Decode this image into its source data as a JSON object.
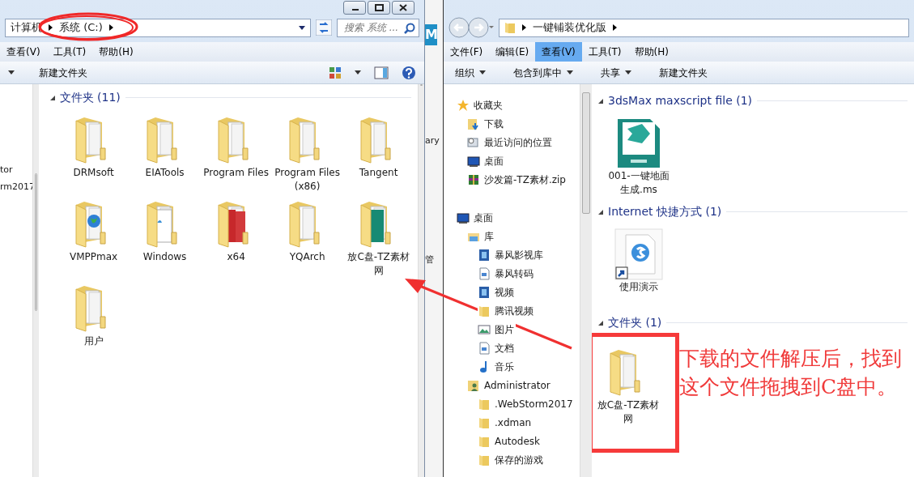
{
  "left_window": {
    "breadcrumbs": [
      "计算机",
      "系统 (C:)"
    ],
    "search": {
      "placeholder": "搜索 系统 ..."
    },
    "menu": [
      {
        "label": "查看(V)",
        "selected": false
      },
      {
        "label": "工具(T)",
        "selected": false
      },
      {
        "label": "帮助(H)",
        "selected": false
      }
    ],
    "toolbar": [
      {
        "label": "新建文件夹",
        "dropdown": false
      }
    ],
    "nav_pane": [
      "tor",
      "rm2017"
    ],
    "group": {
      "title": "文件夹 (11)",
      "items": [
        {
          "name": "DRMsoft",
          "kind": "folder"
        },
        {
          "name": "EIATools",
          "kind": "folder"
        },
        {
          "name": "Program Files",
          "kind": "folder"
        },
        {
          "name": "Program Files (x86)",
          "kind": "folder"
        },
        {
          "name": "Tangent",
          "kind": "folder"
        },
        {
          "name": "VMPPmax",
          "kind": "folder_web"
        },
        {
          "name": "Windows",
          "kind": "folder_docs"
        },
        {
          "name": "x64",
          "kind": "folder_pdf"
        },
        {
          "name": "YQArch",
          "kind": "folder"
        },
        {
          "name": "放C盘-TZ素材网",
          "kind": "folder_sheet"
        },
        {
          "name": "用户",
          "kind": "folder"
        }
      ]
    }
  },
  "background_window": {
    "texts": [
      "M",
      "ary",
      "管"
    ]
  },
  "right_window": {
    "breadcrumbs": [
      "一键铺装优化版"
    ],
    "menu": [
      {
        "label": "文件(F)",
        "selected": false
      },
      {
        "label": "编辑(E)",
        "selected": false
      },
      {
        "label": "查看(V)",
        "selected": true
      },
      {
        "label": "工具(T)",
        "selected": false
      },
      {
        "label": "帮助(H)",
        "selected": false
      }
    ],
    "toolbar": [
      {
        "label": "组织",
        "dropdown": true
      },
      {
        "label": "包含到库中",
        "dropdown": true
      },
      {
        "label": "共享",
        "dropdown": true
      },
      {
        "label": "新建文件夹",
        "dropdown": false
      }
    ],
    "nav_tree": [
      {
        "label": "收藏夹",
        "kind": "star",
        "children": [
          {
            "label": "下载",
            "kind": "download"
          },
          {
            "label": "最近访问的位置",
            "kind": "recent"
          },
          {
            "label": "桌面",
            "kind": "desktop"
          },
          {
            "label": "沙发篇-TZ素材.zip",
            "kind": "archive"
          }
        ]
      },
      {
        "label": "桌面",
        "kind": "desktop",
        "children": [
          {
            "label": "库",
            "kind": "library",
            "children": [
              {
                "label": "暴风影视库",
                "kind": "video"
              },
              {
                "label": "暴风转码",
                "kind": "doc"
              },
              {
                "label": "视频",
                "kind": "video"
              },
              {
                "label": "腾讯视频",
                "kind": "folder"
              },
              {
                "label": "图片",
                "kind": "picture"
              },
              {
                "label": "文档",
                "kind": "doc"
              },
              {
                "label": "音乐",
                "kind": "music"
              }
            ]
          },
          {
            "label": "Administrator",
            "kind": "user",
            "children": [
              {
                "label": ".WebStorm2017",
                "kind": "folder"
              },
              {
                "label": ".xdman",
                "kind": "folder"
              },
              {
                "label": "Autodesk",
                "kind": "folder"
              },
              {
                "label": "保存的游戏",
                "kind": "folder"
              }
            ]
          }
        ]
      }
    ],
    "groups": [
      {
        "title": "3dsMax maxscript file (1)",
        "items": [
          {
            "name": "001-一键地面生成.ms",
            "kind": "maxscript"
          }
        ]
      },
      {
        "title": "Internet 快捷方式 (1)",
        "items": [
          {
            "name": "使用演示",
            "kind": "shortcut"
          }
        ]
      },
      {
        "title": "文件夹 (1)",
        "items": [
          {
            "name": "放C盘-TZ素材网",
            "kind": "folder"
          }
        ]
      }
    ]
  },
  "annotation": {
    "note": "下载的文件解压后，找到这个文件拖拽到C盘中。"
  }
}
